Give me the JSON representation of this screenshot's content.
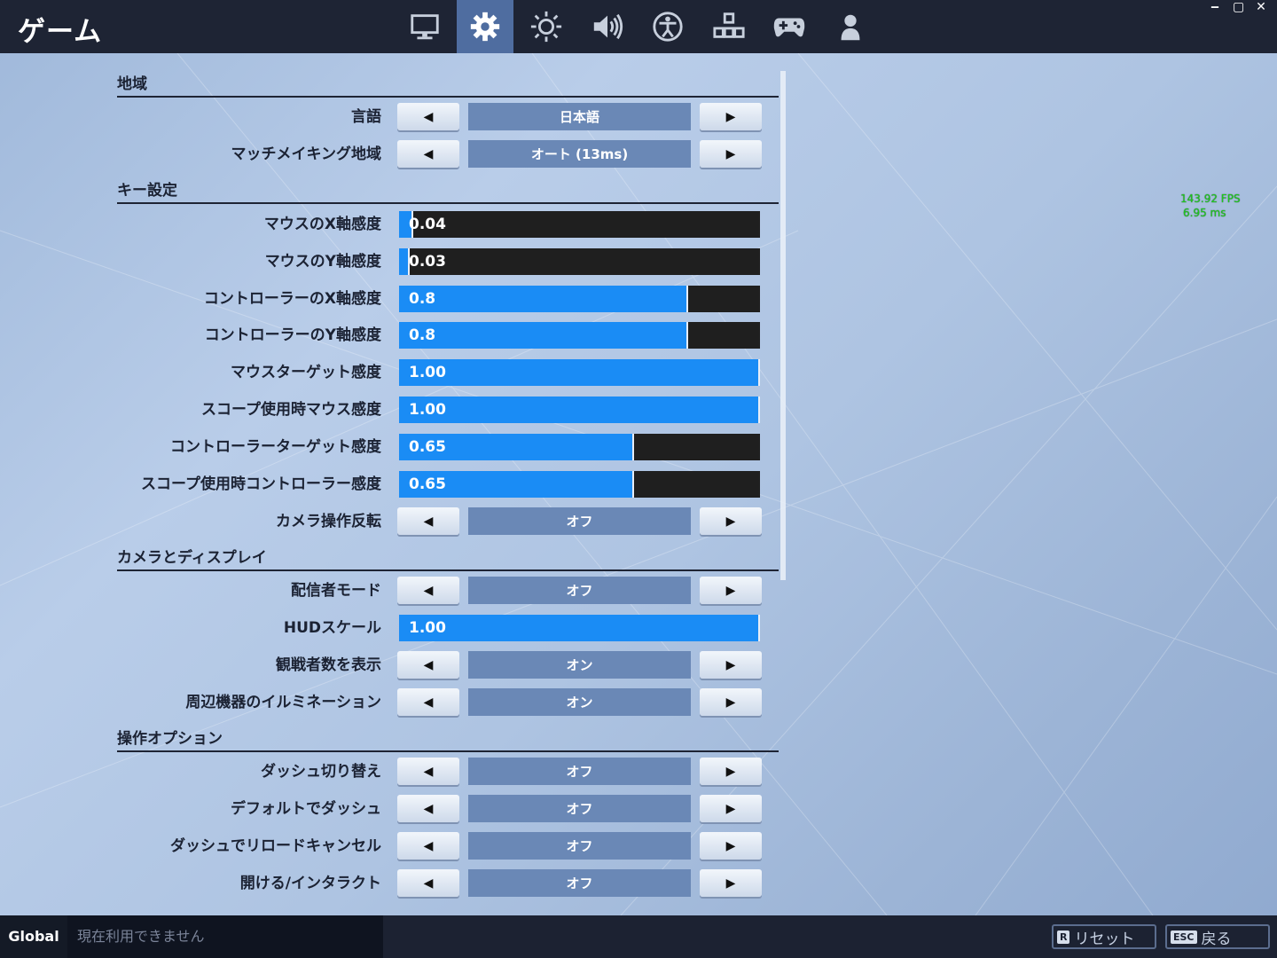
{
  "window": {
    "title": "ゲーム",
    "controls": [
      "‒",
      "▢",
      "✕"
    ]
  },
  "tabs": [
    {
      "icon": "monitor-icon",
      "active": false
    },
    {
      "icon": "gear-icon",
      "active": true
    },
    {
      "icon": "brightness-icon",
      "active": false
    },
    {
      "icon": "speaker-icon",
      "active": false
    },
    {
      "icon": "accessibility-icon",
      "active": false
    },
    {
      "icon": "input-keys-icon",
      "active": false
    },
    {
      "icon": "gamepad-icon",
      "active": false
    },
    {
      "icon": "account-icon",
      "active": false
    }
  ],
  "arrows": {
    "left": "◀",
    "right": "▶"
  },
  "sections": {
    "region": "地域",
    "keys": "キー設定",
    "camera": "カメラとディスプレイ",
    "controls": "操作オプション"
  },
  "settings": {
    "language": {
      "label": "言語",
      "value": "日本語"
    },
    "matchmaking": {
      "label": "マッチメイキング地域",
      "value": "オート (13ms)"
    },
    "mouse_x": {
      "label": "マウスのX軸感度",
      "value": "0.04",
      "fraction": 0.04
    },
    "mouse_y": {
      "label": "マウスのY軸感度",
      "value": "0.03",
      "fraction": 0.03
    },
    "ctrl_x": {
      "label": "コントローラーのX軸感度",
      "value": "0.8",
      "fraction": 0.8
    },
    "ctrl_y": {
      "label": "コントローラーのY軸感度",
      "value": "0.8",
      "fraction": 0.8
    },
    "mouse_target": {
      "label": "マウスターゲット感度",
      "value": "1.00",
      "fraction": 1.0
    },
    "scope_mouse": {
      "label": "スコープ使用時マウス感度",
      "value": "1.00",
      "fraction": 1.0
    },
    "ctrl_target": {
      "label": "コントローラーターゲット感度",
      "value": "0.65",
      "fraction": 0.65
    },
    "scope_ctrl": {
      "label": "スコープ使用時コントローラー感度",
      "value": "0.65",
      "fraction": 0.65
    },
    "invert_camera": {
      "label": "カメラ操作反転",
      "value": "オフ"
    },
    "streamer_mode": {
      "label": "配信者モード",
      "value": "オフ"
    },
    "hud_scale": {
      "label": "HUDスケール",
      "value": "1.00",
      "fraction": 1.0
    },
    "spectator_count": {
      "label": "観戦者数を表示",
      "value": "オン"
    },
    "peripheral_lighting": {
      "label": "周辺機器のイルミネーション",
      "value": "オン"
    },
    "toggle_sprint": {
      "label": "ダッシュ切り替え",
      "value": "オフ"
    },
    "sprint_default": {
      "label": "デフォルトでダッシュ",
      "value": "オフ"
    },
    "sprint_cancel_reload": {
      "label": "ダッシュでリロードキャンセル",
      "value": "オフ"
    },
    "open_interact": {
      "label": "開ける/インタラクト",
      "value": "オフ"
    }
  },
  "perf": {
    "fps": "143.92 FPS",
    "ms": "6.95 ms"
  },
  "footer": {
    "chat_channel": "Global",
    "chat_placeholder": "現在利用できません",
    "reset_key": "R",
    "reset_label": "リセット",
    "back_key": "ESC",
    "back_label": "戻る"
  }
}
